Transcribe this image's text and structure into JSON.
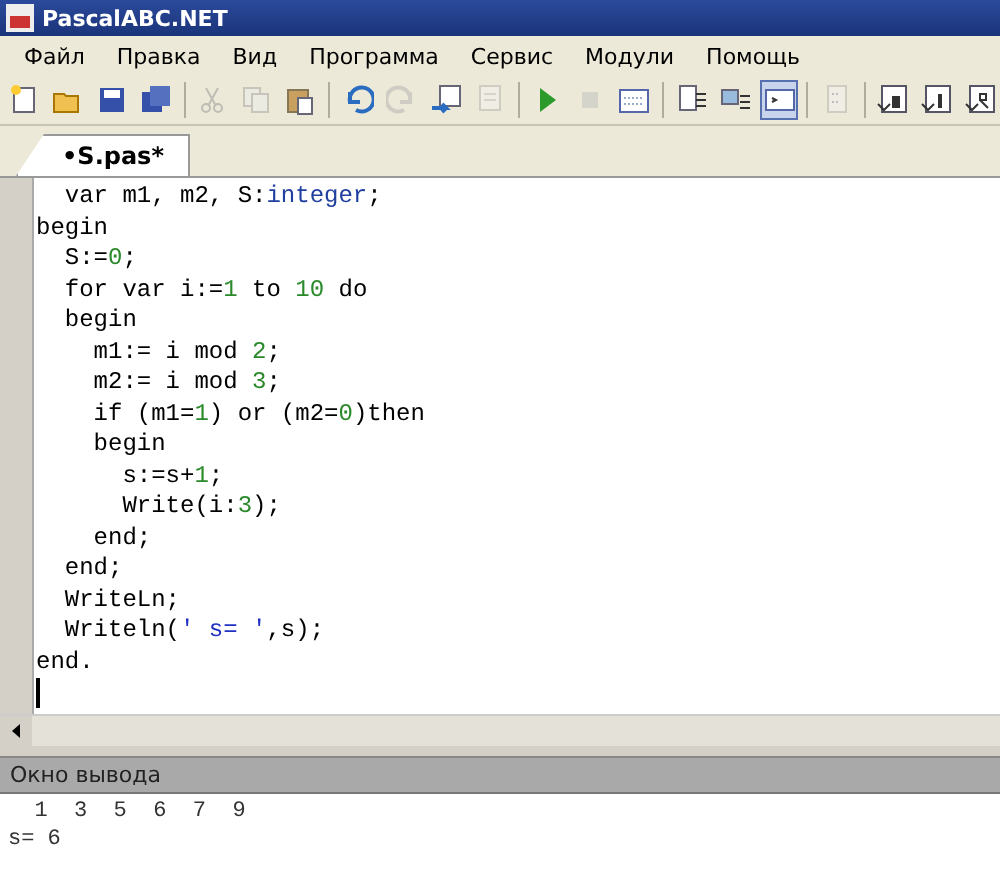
{
  "window": {
    "title": "PascalABC.NET"
  },
  "menu": [
    "Файл",
    "Правка",
    "Вид",
    "Программа",
    "Сервис",
    "Модули",
    "Помощь"
  ],
  "toolbar": [
    {
      "kind": "new",
      "disabled": false,
      "selected": false
    },
    {
      "kind": "open",
      "disabled": false,
      "selected": false
    },
    {
      "kind": "save",
      "disabled": false,
      "selected": false
    },
    {
      "kind": "save-all",
      "disabled": false,
      "selected": false
    },
    {
      "kind": "separator"
    },
    {
      "kind": "cut",
      "disabled": true,
      "selected": false
    },
    {
      "kind": "copy",
      "disabled": true,
      "selected": false
    },
    {
      "kind": "paste",
      "disabled": false,
      "selected": false
    },
    {
      "kind": "separator"
    },
    {
      "kind": "undo",
      "disabled": false,
      "selected": false
    },
    {
      "kind": "redo",
      "disabled": true,
      "selected": false
    },
    {
      "kind": "doc-in",
      "disabled": false,
      "selected": false
    },
    {
      "kind": "doc-out",
      "disabled": true,
      "selected": false
    },
    {
      "kind": "separator"
    },
    {
      "kind": "run",
      "disabled": false,
      "selected": false
    },
    {
      "kind": "stop",
      "disabled": true,
      "selected": false
    },
    {
      "kind": "calendar",
      "disabled": false,
      "selected": false
    },
    {
      "kind": "separator"
    },
    {
      "kind": "indent",
      "disabled": false,
      "selected": false
    },
    {
      "kind": "outdent",
      "disabled": false,
      "selected": false
    },
    {
      "kind": "console",
      "disabled": false,
      "selected": true
    },
    {
      "kind": "separator"
    },
    {
      "kind": "doc-dots",
      "disabled": true,
      "selected": false
    },
    {
      "kind": "separator"
    },
    {
      "kind": "step-d",
      "disabled": false,
      "selected": false
    },
    {
      "kind": "step-l",
      "disabled": false,
      "selected": false
    },
    {
      "kind": "step-r",
      "disabled": false,
      "selected": false
    }
  ],
  "tabs": [
    {
      "label": "•S.pas*",
      "selected": true
    }
  ],
  "code": [
    [
      {
        "kind": "plain",
        "text": "  var m1, m2, S:"
      },
      {
        "kind": "type",
        "text": "integer"
      },
      {
        "kind": "plain",
        "text": ";"
      }
    ],
    [
      {
        "kind": "plain",
        "text": "begin"
      }
    ],
    [
      {
        "kind": "plain",
        "text": "  S:="
      },
      {
        "kind": "number",
        "text": "0"
      },
      {
        "kind": "plain",
        "text": ";"
      }
    ],
    [
      {
        "kind": "plain",
        "text": "  for var i:="
      },
      {
        "kind": "number",
        "text": "1"
      },
      {
        "kind": "plain",
        "text": " to "
      },
      {
        "kind": "number",
        "text": "10"
      },
      {
        "kind": "plain",
        "text": " do"
      }
    ],
    [
      {
        "kind": "plain",
        "text": "  begin"
      }
    ],
    [
      {
        "kind": "plain",
        "text": "    m1:= i mod "
      },
      {
        "kind": "number",
        "text": "2"
      },
      {
        "kind": "plain",
        "text": ";"
      }
    ],
    [
      {
        "kind": "plain",
        "text": "    m2:= i mod "
      },
      {
        "kind": "number",
        "text": "3"
      },
      {
        "kind": "plain",
        "text": ";"
      }
    ],
    [
      {
        "kind": "plain",
        "text": "    if (m1="
      },
      {
        "kind": "number",
        "text": "1"
      },
      {
        "kind": "plain",
        "text": ") or (m2="
      },
      {
        "kind": "number",
        "text": "0"
      },
      {
        "kind": "plain",
        "text": ")then"
      }
    ],
    [
      {
        "kind": "plain",
        "text": "    begin"
      }
    ],
    [
      {
        "kind": "plain",
        "text": "      s:=s+"
      },
      {
        "kind": "number",
        "text": "1"
      },
      {
        "kind": "plain",
        "text": ";"
      }
    ],
    [
      {
        "kind": "plain",
        "text": "      Write(i:"
      },
      {
        "kind": "number",
        "text": "3"
      },
      {
        "kind": "plain",
        "text": ");"
      }
    ],
    [
      {
        "kind": "plain",
        "text": "    end;"
      }
    ],
    [
      {
        "kind": "plain",
        "text": "  end;"
      }
    ],
    [
      {
        "kind": "plain",
        "text": "  WriteLn;"
      }
    ],
    [
      {
        "kind": "plain",
        "text": "  Writeln("
      },
      {
        "kind": "string",
        "text": "' s= '"
      },
      {
        "kind": "plain",
        "text": ",s);"
      }
    ],
    [
      {
        "kind": "plain",
        "text": "end."
      }
    ]
  ],
  "output_panel": {
    "title": "Окно вывода",
    "lines": [
      "  1  3  5  6  7  9",
      "s= 6"
    ]
  }
}
